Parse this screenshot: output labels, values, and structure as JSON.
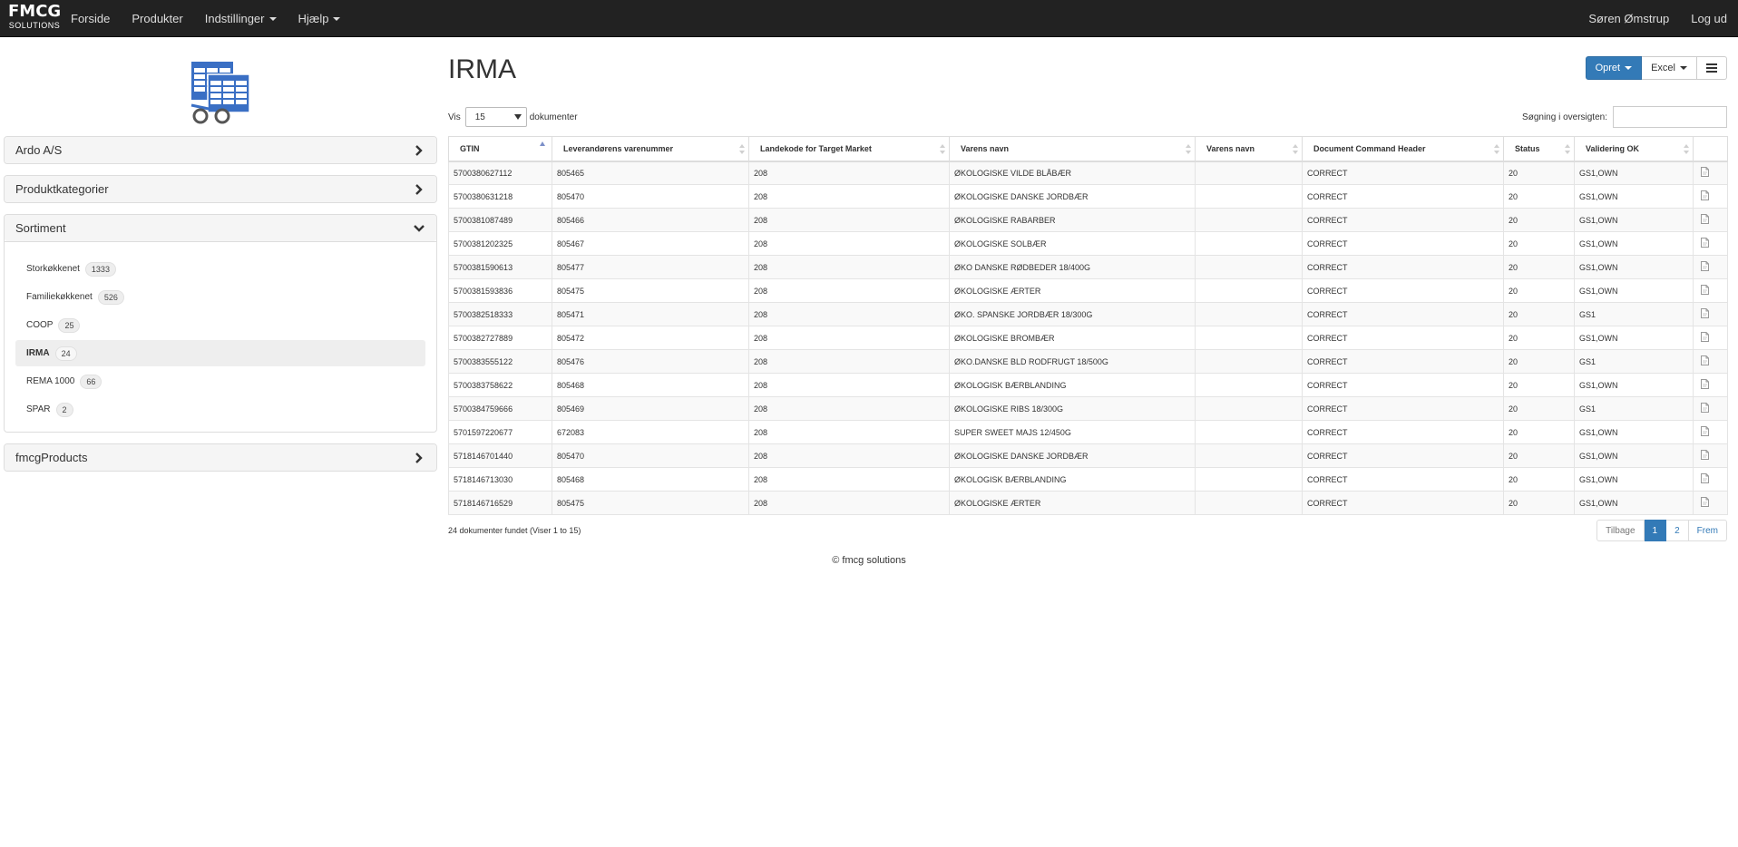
{
  "brand": {
    "line1": "FMCG",
    "line2": "SOLUTIONS"
  },
  "nav": {
    "left": [
      {
        "label": "Forside",
        "dropdown": false
      },
      {
        "label": "Produkter",
        "dropdown": false
      },
      {
        "label": "Indstillinger",
        "dropdown": true
      },
      {
        "label": "Hjælp",
        "dropdown": true
      }
    ],
    "right": [
      {
        "label": "Søren Ømstrup"
      },
      {
        "label": "Log ud"
      }
    ]
  },
  "sidebar": {
    "panels": [
      {
        "title": "Ardo A/S",
        "expanded": false
      },
      {
        "title": "Produktkategorier",
        "expanded": false
      },
      {
        "title": "Sortiment",
        "expanded": true
      },
      {
        "title": "fmcgProducts",
        "expanded": false
      }
    ],
    "sortiment": [
      {
        "label": "Storkøkkenet",
        "count": "1333",
        "active": false
      },
      {
        "label": "Familiekøkkenet",
        "count": "526",
        "active": false
      },
      {
        "label": "COOP",
        "count": "25",
        "active": false
      },
      {
        "label": "IRMA",
        "count": "24",
        "active": true
      },
      {
        "label": "REMA 1000",
        "count": "66",
        "active": false
      },
      {
        "label": "SPAR",
        "count": "2",
        "active": false
      }
    ]
  },
  "main": {
    "title": "IRMA",
    "buttons": {
      "create": "Opret",
      "excel": "Excel",
      "menu_icon": "menu-icon"
    },
    "length": {
      "prefix": "Vis",
      "value": "15",
      "suffix": "dokumenter"
    },
    "search": {
      "label": "Søgning i oversigten:",
      "value": "",
      "placeholder": ""
    },
    "columns": [
      "GTIN",
      "Leverandørens varenummer",
      "Landekode for Target Market",
      "Varens navn",
      "Varens navn",
      "Document Command Header",
      "Status",
      "Validering OK",
      ""
    ],
    "rows": [
      [
        "5700380627112",
        "805465",
        "208",
        "ØKOLOGISKE VILDE BLÅBÆR",
        "",
        "CORRECT",
        "20",
        "GS1,OWN"
      ],
      [
        "5700380631218",
        "805470",
        "208",
        "ØKOLOGISKE DANSKE JORDBÆR",
        "",
        "CORRECT",
        "20",
        "GS1,OWN"
      ],
      [
        "5700381087489",
        "805466",
        "208",
        "ØKOLOGISKE RABARBER",
        "",
        "CORRECT",
        "20",
        "GS1,OWN"
      ],
      [
        "5700381202325",
        "805467",
        "208",
        "ØKOLOGISKE SOLBÆR",
        "",
        "CORRECT",
        "20",
        "GS1,OWN"
      ],
      [
        "5700381590613",
        "805477",
        "208",
        "ØKO DANSKE RØDBEDER 18/400G",
        "",
        "CORRECT",
        "20",
        "GS1,OWN"
      ],
      [
        "5700381593836",
        "805475",
        "208",
        "ØKOLOGISKE ÆRTER",
        "",
        "CORRECT",
        "20",
        "GS1,OWN"
      ],
      [
        "5700382518333",
        "805471",
        "208",
        "ØKO. SPANSKE JORDBÆR 18/300G",
        "",
        "CORRECT",
        "20",
        "GS1"
      ],
      [
        "5700382727889",
        "805472",
        "208",
        "ØKOLOGISKE BROMBÆR",
        "",
        "CORRECT",
        "20",
        "GS1,OWN"
      ],
      [
        "5700383555122",
        "805476",
        "208",
        "ØKO.DANSKE BLD RODFRUGT 18/500G",
        "",
        "CORRECT",
        "20",
        "GS1"
      ],
      [
        "5700383758622",
        "805468",
        "208",
        "ØKOLOGISK BÆRBLANDING",
        "",
        "CORRECT",
        "20",
        "GS1,OWN"
      ],
      [
        "5700384759666",
        "805469",
        "208",
        "ØKOLOGISKE RIBS 18/300G",
        "",
        "CORRECT",
        "20",
        "GS1"
      ],
      [
        "5701597220677",
        "672083",
        "208",
        "SUPER SWEET MAJS 12/450G",
        "",
        "CORRECT",
        "20",
        "GS1,OWN"
      ],
      [
        "5718146701440",
        "805470",
        "208",
        "ØKOLOGISKE DANSKE JORDBÆR",
        "",
        "CORRECT",
        "20",
        "GS1,OWN"
      ],
      [
        "5718146713030",
        "805468",
        "208",
        "ØKOLOGISK BÆRBLANDING",
        "",
        "CORRECT",
        "20",
        "GS1,OWN"
      ],
      [
        "5718146716529",
        "805475",
        "208",
        "ØKOLOGISKE ÆRTER",
        "",
        "CORRECT",
        "20",
        "GS1,OWN"
      ]
    ],
    "info": "24 dokumenter fundet (Viser 1 to 15)",
    "pager": [
      {
        "label": "Tilbage",
        "active": false
      },
      {
        "label": "1",
        "active": true
      },
      {
        "label": "2",
        "active": false
      },
      {
        "label": "Frem",
        "active": false
      }
    ]
  },
  "footer": "© fmcg solutions",
  "colors": {
    "navbar": "#222222",
    "primary": "#337ab7",
    "panel_head": "#f5f5f5"
  }
}
